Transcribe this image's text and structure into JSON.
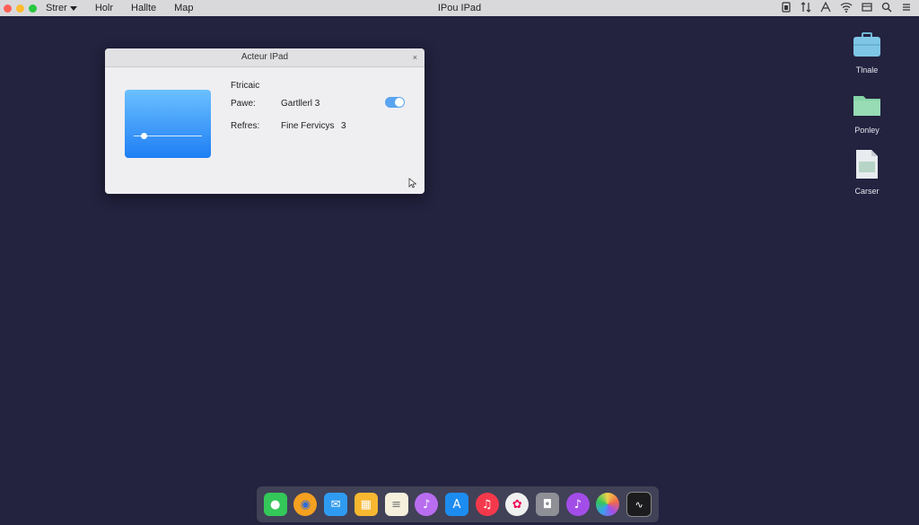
{
  "menubar": {
    "menus": [
      {
        "label": "Strer",
        "has_caret": true
      },
      {
        "label": "Holr"
      },
      {
        "label": "Hallte"
      },
      {
        "label": "Map"
      }
    ],
    "title": "IPou IPad",
    "traffic_colors": [
      "#fe5f57",
      "#febb2e",
      "#28c840"
    ]
  },
  "dialog": {
    "title": "Acteur IPad",
    "close_glyph": "×",
    "heading": "Ftricaic",
    "rows": [
      {
        "label": "Pawe:",
        "value": "Gartllerl 3"
      },
      {
        "label": "Refres:",
        "value": "Fine Fervicys",
        "extra": "3"
      }
    ],
    "toggle_on": true,
    "slider_level": 0.15
  },
  "desktop": {
    "icons": [
      {
        "label": "Tlnale",
        "type": "briefcase-icon",
        "color": "#7fc6e6"
      },
      {
        "label": "Ponley",
        "type": "folder-icon",
        "color": "#86d4a8"
      },
      {
        "label": "Carser",
        "type": "document-icon",
        "color": "#e8ecef"
      }
    ]
  },
  "dock": {
    "apps": [
      {
        "name": "messages-icon",
        "color": "#34c759"
      },
      {
        "name": "chrome-icon",
        "color": "#f4a020"
      },
      {
        "name": "mail-icon",
        "color": "#2f9bf0"
      },
      {
        "name": "photos-icon",
        "color": "#f7b731"
      },
      {
        "name": "notes-icon",
        "color": "#f5f0dc"
      },
      {
        "name": "itunes-icon",
        "color": "#b86df0"
      },
      {
        "name": "app-store-icon",
        "color": "#1d8cf0"
      },
      {
        "name": "music-icon",
        "color": "#f5394c"
      },
      {
        "name": "photo-library-icon",
        "color": "#f0f0f0"
      },
      {
        "name": "camera-icon",
        "color": "#8f8f96"
      },
      {
        "name": "podcasts-icon",
        "color": "#a34de8"
      },
      {
        "name": "color-wheel-icon",
        "color": "#f0d04a"
      },
      {
        "name": "activity-monitor-icon",
        "color": "#1c1c1e"
      }
    ]
  }
}
